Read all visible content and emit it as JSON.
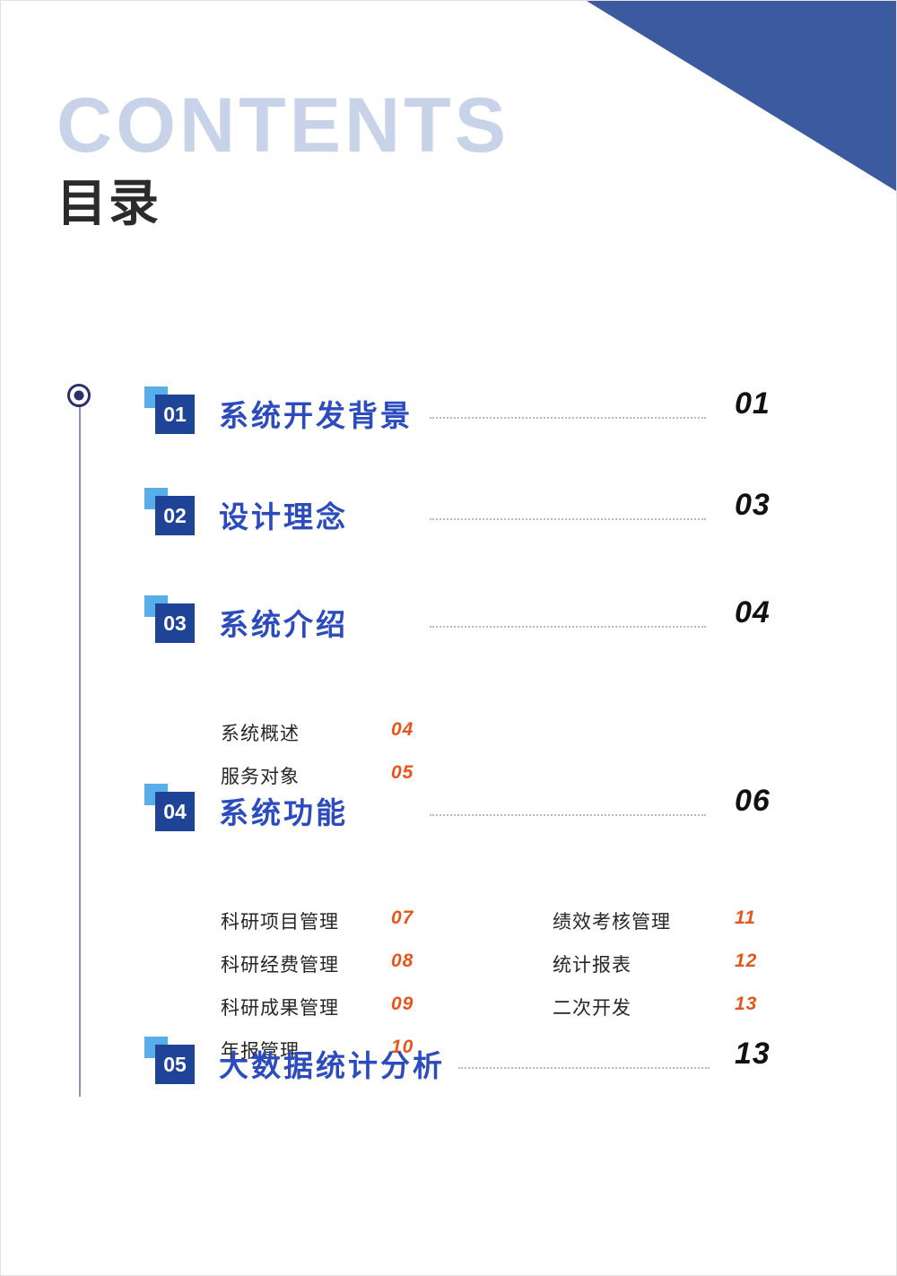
{
  "header": {
    "title_en": "CONTENTS",
    "title_cn": "目录",
    "title_en_color": "#C8D3EA",
    "title_cn_color": "#2B2B2B"
  },
  "theme": {
    "corner_blue": "#3B5AA0",
    "badge_dark_blue": "#1F4396",
    "badge_light_blue": "#57AEE8",
    "section_title_blue": "#2B4BBF",
    "sub_page_orange": "#E8551A",
    "leader_gray": "#B8B8C2",
    "timeline_navy": "#2B2F6B"
  },
  "sections": [
    {
      "number": "01",
      "title": "系统开发背景",
      "page": "01",
      "subs": []
    },
    {
      "number": "02",
      "title": "设计理念",
      "page": "03",
      "subs": []
    },
    {
      "number": "03",
      "title": "系统介绍",
      "page": "04",
      "subs": [
        {
          "label": "系统概述",
          "page": "04",
          "column": "left"
        },
        {
          "label": "服务对象",
          "page": "05",
          "column": "left"
        }
      ]
    },
    {
      "number": "04",
      "title": "系统功能",
      "page": "06",
      "subs": [
        {
          "label": "科研项目管理",
          "page": "07",
          "column": "left"
        },
        {
          "label": "科研经费管理",
          "page": "08",
          "column": "left"
        },
        {
          "label": "科研成果管理",
          "page": "09",
          "column": "left"
        },
        {
          "label": "年报管理",
          "page": "10",
          "column": "left"
        },
        {
          "label": "绩效考核管理",
          "page": "11",
          "column": "right"
        },
        {
          "label": "统计报表",
          "page": "12",
          "column": "right"
        },
        {
          "label": "二次开发",
          "page": "13",
          "column": "right"
        }
      ]
    },
    {
      "number": "05",
      "title": "大数据统计分析",
      "page": "13",
      "subs": []
    }
  ]
}
